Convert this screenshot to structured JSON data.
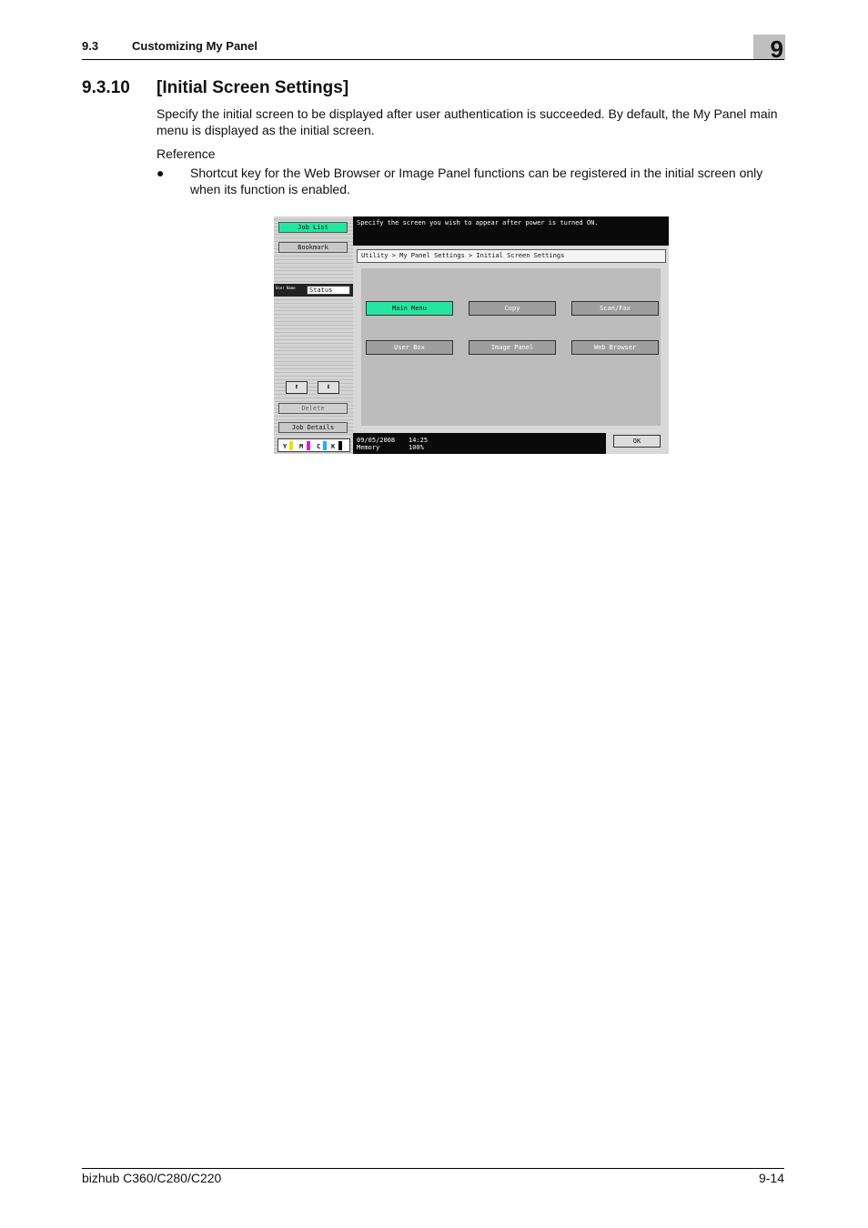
{
  "header": {
    "section": "9.3",
    "title": "Customizing My Panel",
    "chapter": "9"
  },
  "heading": {
    "number": "9.3.10",
    "text": "[Initial Screen Settings]"
  },
  "body": {
    "paragraph": "Specify the initial screen to be displayed after user authentication is succeeded. By default, the My Panel main menu is displayed as the initial screen.",
    "reference_label": "Reference",
    "bullet_symbol": "●",
    "bullet_text": "Shortcut key for the Web Browser or Image Panel functions can be registered in the initial screen only when its function is enabled."
  },
  "screenshot": {
    "sidebar": {
      "job_list": "Job List",
      "bookmark": "Bookmark",
      "user_name": "User Name",
      "status": "Status",
      "up_arrow": "⬆",
      "down_arrow": "⬇",
      "delete": "Delete",
      "job_details": "Job Details",
      "toner": {
        "y": "Y",
        "m": "M",
        "c": "C",
        "k": "K"
      }
    },
    "message": "Specify the screen you wish to appear after power is turned ON.",
    "breadcrumb": "Utility > My Panel Settings > Initial Screen Settings",
    "buttons": {
      "main_menu": "Main Menu",
      "copy": "Copy",
      "scan_fax": "Scan/Fax",
      "user_box": "User Box",
      "image_panel": "Image Panel",
      "web_browser": "Web Browser"
    },
    "status": {
      "date": "09/05/2008",
      "time": "14:25",
      "memory_label": "Memory",
      "memory_value": "100%"
    },
    "ok": "OK"
  },
  "footer": {
    "model": "bizhub C360/C280/C220",
    "page": "9-14"
  },
  "colors": {
    "selected": "#25e6a0",
    "chapter_box": "#bfbfbf"
  }
}
